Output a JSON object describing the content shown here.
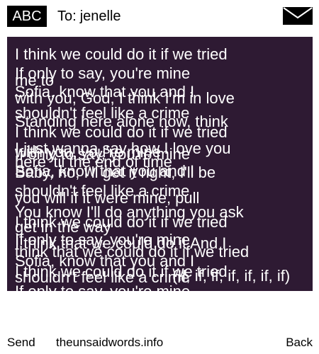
{
  "header": {
    "mode_label": "ABC",
    "to_label": "To:",
    "recipient": "jenelle",
    "mail_icon": "envelope-icon"
  },
  "message": {
    "lines": [
      "I think we could do it if we tried",
      "If only to say, you're mine",
      "me to",
      "Sofia, know that you and I",
      "with you, God, I think I'm in love",
      "shouldn't feel like a crime",
      "Standing here alone now, think",
      "I think we could do it if we tried",
      "I just wanna say how I love you",
      "with you, you're mine",
      "If only to say, you're mine",
      "here 'til the end of time",
      "Sofia, know that you and I",
      "Baby, no, I'll get it right, I'll be",
      "shouldn't feel like a crime",
      "you will if it were mine, pull",
      "You know I'll do anything you ask",
      "I think we could do it if we tried",
      "get in the way",
      "If only to say, you're mine",
      "I think that we could do it And I",
      "think that we could do it if we tried",
      "Sofia, know that you and I",
      "I think we could do it if we tried",
      "shouldn't feel like a crime",
      "(If, if, if, if, if, if, if)",
      "If only to say, you're mine"
    ]
  },
  "footer": {
    "send_label": "Send",
    "site_label": "theunsaidwords.info",
    "back_label": "Back"
  },
  "colors": {
    "message_background": "#2e1a33",
    "text_on_message": "#ffffff"
  }
}
